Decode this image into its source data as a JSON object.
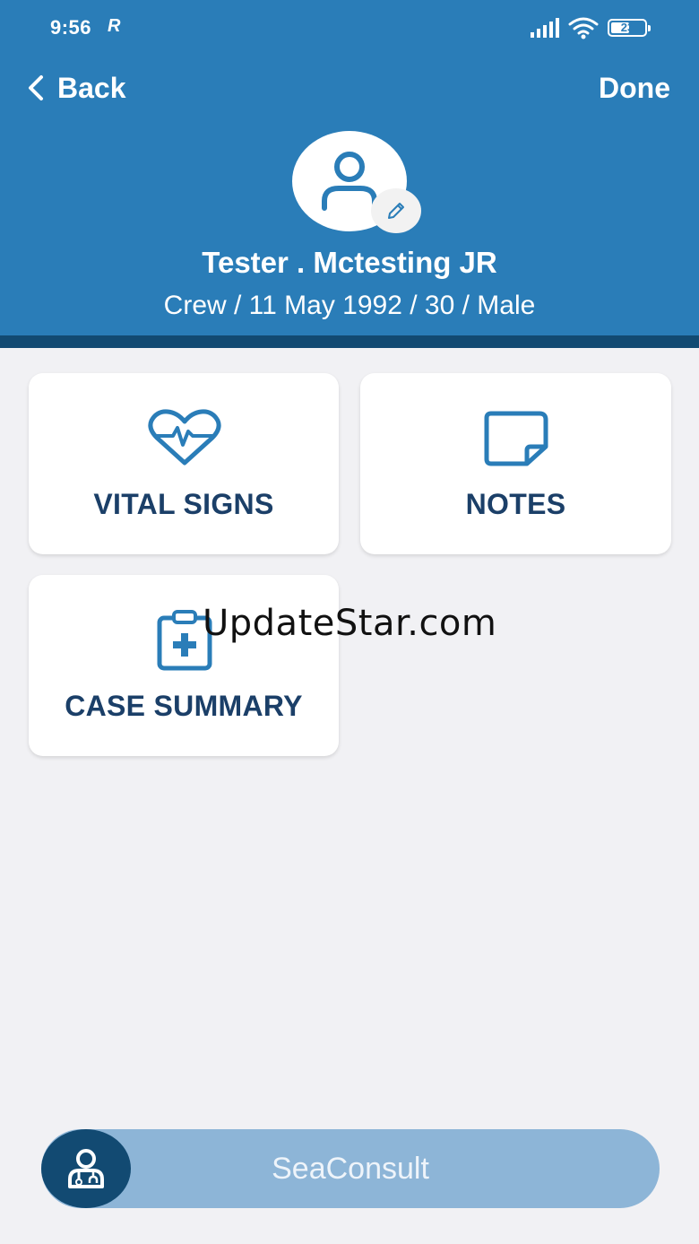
{
  "status_bar": {
    "time": "9:56",
    "carrier_icon": "R",
    "battery_level": "23"
  },
  "nav": {
    "back_label": "Back",
    "done_label": "Done"
  },
  "patient": {
    "name": "Tester . Mctesting JR",
    "details": "Crew / 11 May 1992 / 30 / Male"
  },
  "cards": [
    {
      "label": "VITAL SIGNS",
      "icon": "heart-pulse-icon"
    },
    {
      "label": "NOTES",
      "icon": "note-icon"
    },
    {
      "label": "CASE SUMMARY",
      "icon": "clipboard-medical-icon"
    }
  ],
  "watermark": "UpdateStar.com",
  "sea_consult": {
    "label": "SeaConsult",
    "icon": "doctor-icon"
  },
  "colors": {
    "header": "#2a7db8",
    "header_rule": "#124a72",
    "card_text": "#1b3f68",
    "icon": "#2a7db8",
    "sea_button": "#8db5d7",
    "background": "#f1f1f4"
  }
}
